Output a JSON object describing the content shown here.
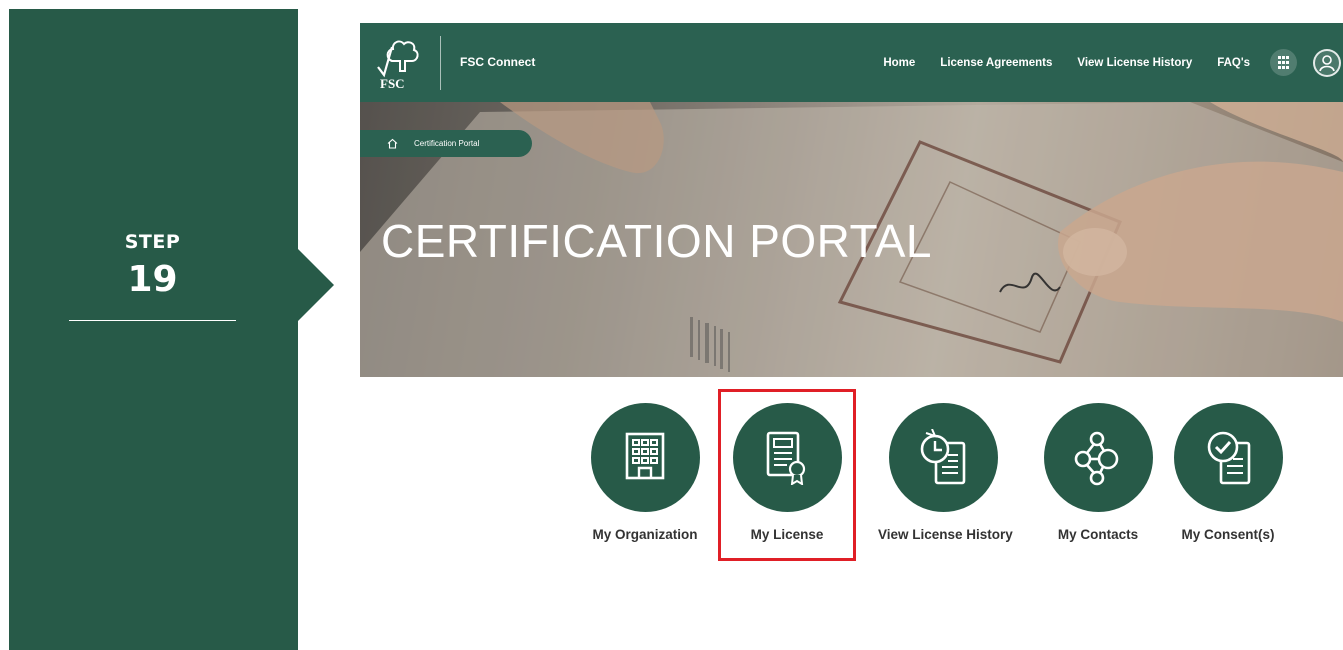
{
  "step": {
    "label": "STEP",
    "number": "19"
  },
  "navbar": {
    "brand": "FSC Connect",
    "logo_text": "FSC",
    "links": [
      "Home",
      "License Agreements",
      "View License History",
      "FAQ's"
    ]
  },
  "breadcrumb": {
    "label": "Certification Portal"
  },
  "hero": {
    "title": "CERTIFICATION PORTAL"
  },
  "tiles": [
    {
      "label": "My Organization",
      "icon": "building-icon"
    },
    {
      "label": "My License",
      "icon": "license-certificate-icon",
      "highlighted": true
    },
    {
      "label": "View License History",
      "icon": "history-document-icon"
    },
    {
      "label": "My Contacts",
      "icon": "network-nodes-icon"
    },
    {
      "label": "My Consent(s)",
      "icon": "consent-checkmark-icon"
    }
  ],
  "colors": {
    "brand_green": "#275a48",
    "nav_green": "#2b6151",
    "highlight": "#e01f26"
  }
}
